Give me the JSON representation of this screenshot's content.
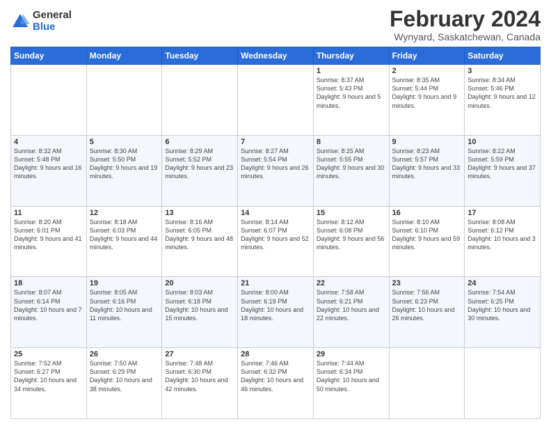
{
  "logo": {
    "general": "General",
    "blue": "Blue"
  },
  "header": {
    "title": "February 2024",
    "subtitle": "Wynyard, Saskatchewan, Canada"
  },
  "days_of_week": [
    "Sunday",
    "Monday",
    "Tuesday",
    "Wednesday",
    "Thursday",
    "Friday",
    "Saturday"
  ],
  "weeks": [
    [
      {
        "day": "",
        "info": ""
      },
      {
        "day": "",
        "info": ""
      },
      {
        "day": "",
        "info": ""
      },
      {
        "day": "",
        "info": ""
      },
      {
        "day": "1",
        "info": "Sunrise: 8:37 AM\nSunset: 5:43 PM\nDaylight: 9 hours and 5 minutes."
      },
      {
        "day": "2",
        "info": "Sunrise: 8:35 AM\nSunset: 5:44 PM\nDaylight: 9 hours and 9 minutes."
      },
      {
        "day": "3",
        "info": "Sunrise: 8:34 AM\nSunset: 5:46 PM\nDaylight: 9 hours and 12 minutes."
      }
    ],
    [
      {
        "day": "4",
        "info": "Sunrise: 8:32 AM\nSunset: 5:48 PM\nDaylight: 9 hours and 16 minutes."
      },
      {
        "day": "5",
        "info": "Sunrise: 8:30 AM\nSunset: 5:50 PM\nDaylight: 9 hours and 19 minutes."
      },
      {
        "day": "6",
        "info": "Sunrise: 8:29 AM\nSunset: 5:52 PM\nDaylight: 9 hours and 23 minutes."
      },
      {
        "day": "7",
        "info": "Sunrise: 8:27 AM\nSunset: 5:54 PM\nDaylight: 9 hours and 26 minutes."
      },
      {
        "day": "8",
        "info": "Sunrise: 8:25 AM\nSunset: 5:55 PM\nDaylight: 9 hours and 30 minutes."
      },
      {
        "day": "9",
        "info": "Sunrise: 8:23 AM\nSunset: 5:57 PM\nDaylight: 9 hours and 33 minutes."
      },
      {
        "day": "10",
        "info": "Sunrise: 8:22 AM\nSunset: 5:59 PM\nDaylight: 9 hours and 37 minutes."
      }
    ],
    [
      {
        "day": "11",
        "info": "Sunrise: 8:20 AM\nSunset: 6:01 PM\nDaylight: 9 hours and 41 minutes."
      },
      {
        "day": "12",
        "info": "Sunrise: 8:18 AM\nSunset: 6:03 PM\nDaylight: 9 hours and 44 minutes."
      },
      {
        "day": "13",
        "info": "Sunrise: 8:16 AM\nSunset: 6:05 PM\nDaylight: 9 hours and 48 minutes."
      },
      {
        "day": "14",
        "info": "Sunrise: 8:14 AM\nSunset: 6:07 PM\nDaylight: 9 hours and 52 minutes."
      },
      {
        "day": "15",
        "info": "Sunrise: 8:12 AM\nSunset: 6:08 PM\nDaylight: 9 hours and 56 minutes."
      },
      {
        "day": "16",
        "info": "Sunrise: 8:10 AM\nSunset: 6:10 PM\nDaylight: 9 hours and 59 minutes."
      },
      {
        "day": "17",
        "info": "Sunrise: 8:08 AM\nSunset: 6:12 PM\nDaylight: 10 hours and 3 minutes."
      }
    ],
    [
      {
        "day": "18",
        "info": "Sunrise: 8:07 AM\nSunset: 6:14 PM\nDaylight: 10 hours and 7 minutes."
      },
      {
        "day": "19",
        "info": "Sunrise: 8:05 AM\nSunset: 6:16 PM\nDaylight: 10 hours and 11 minutes."
      },
      {
        "day": "20",
        "info": "Sunrise: 8:03 AM\nSunset: 6:18 PM\nDaylight: 10 hours and 15 minutes."
      },
      {
        "day": "21",
        "info": "Sunrise: 8:00 AM\nSunset: 6:19 PM\nDaylight: 10 hours and 18 minutes."
      },
      {
        "day": "22",
        "info": "Sunrise: 7:58 AM\nSunset: 6:21 PM\nDaylight: 10 hours and 22 minutes."
      },
      {
        "day": "23",
        "info": "Sunrise: 7:56 AM\nSunset: 6:23 PM\nDaylight: 10 hours and 26 minutes."
      },
      {
        "day": "24",
        "info": "Sunrise: 7:54 AM\nSunset: 6:25 PM\nDaylight: 10 hours and 30 minutes."
      }
    ],
    [
      {
        "day": "25",
        "info": "Sunrise: 7:52 AM\nSunset: 6:27 PM\nDaylight: 10 hours and 34 minutes."
      },
      {
        "day": "26",
        "info": "Sunrise: 7:50 AM\nSunset: 6:29 PM\nDaylight: 10 hours and 38 minutes."
      },
      {
        "day": "27",
        "info": "Sunrise: 7:48 AM\nSunset: 6:30 PM\nDaylight: 10 hours and 42 minutes."
      },
      {
        "day": "28",
        "info": "Sunrise: 7:46 AM\nSunset: 6:32 PM\nDaylight: 10 hours and 46 minutes."
      },
      {
        "day": "29",
        "info": "Sunrise: 7:44 AM\nSunset: 6:34 PM\nDaylight: 10 hours and 50 minutes."
      },
      {
        "day": "",
        "info": ""
      },
      {
        "day": "",
        "info": ""
      }
    ]
  ]
}
